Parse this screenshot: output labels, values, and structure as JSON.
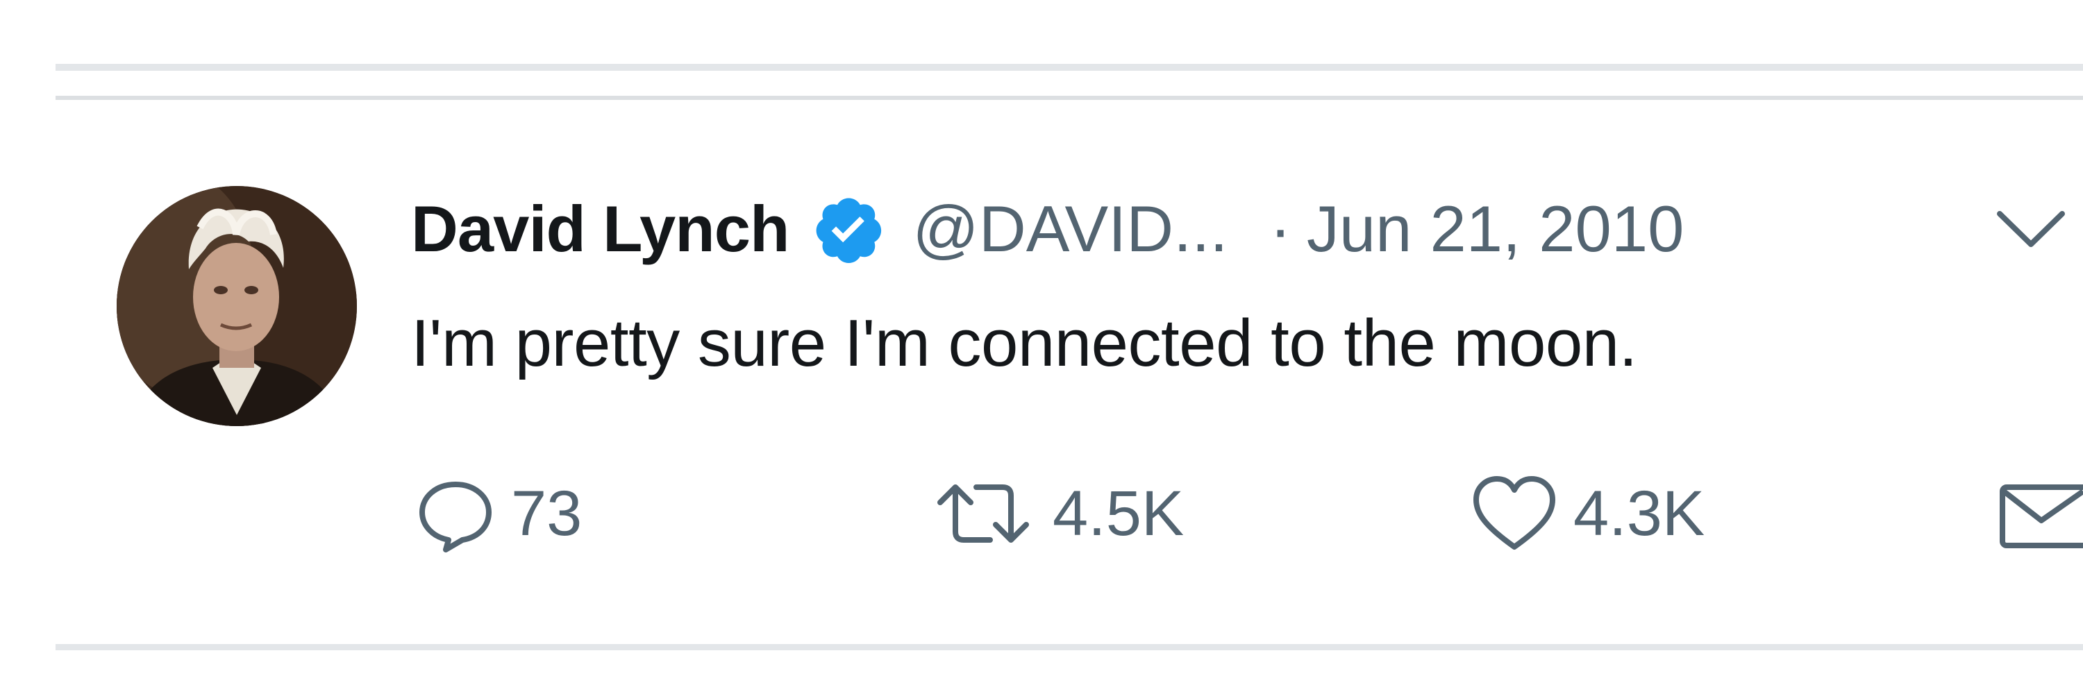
{
  "tweet": {
    "author": {
      "display_name": "David Lynch",
      "handle": "@DAVID...",
      "verified": true,
      "avatar": "profile-photo"
    },
    "separator": "·",
    "date": "Jun 21, 2010",
    "text": "I'm pretty sure I'm connected to the moon.",
    "actions": {
      "reply": {
        "icon": "reply-icon",
        "count": "73"
      },
      "retweet": {
        "icon": "retweet-icon",
        "count": "4.5K"
      },
      "like": {
        "icon": "heart-icon",
        "count": "4.3K"
      },
      "share": {
        "icon": "share-icon"
      }
    },
    "menu": {
      "icon": "chevron-down-icon"
    }
  },
  "colors": {
    "text_primary": "#14171a",
    "text_secondary": "#536471",
    "verified_blue": "#1d9bf0",
    "divider": "#e6e9ec"
  }
}
